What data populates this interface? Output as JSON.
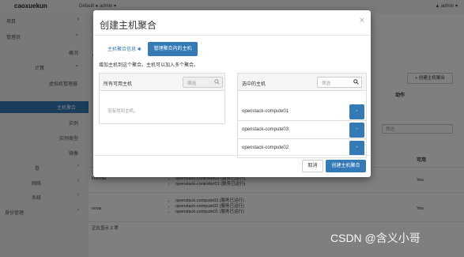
{
  "topbar": {
    "brand": "caoxuekun",
    "project": "Default ● admin ▾",
    "user": "▲ admin ▾"
  },
  "sidebar": {
    "items": [
      {
        "label": "项目",
        "chevron": "›"
      },
      {
        "label": "管理员",
        "chevron": "⌄"
      },
      {
        "label": "概况",
        "chevron": ""
      },
      {
        "label": "计算",
        "chevron": "⌄"
      },
      {
        "label": "虚拟机管理器",
        "chevron": ""
      },
      {
        "label": "主机聚合",
        "chevron": ""
      },
      {
        "label": "实例",
        "chevron": ""
      },
      {
        "label": "实例类型",
        "chevron": ""
      },
      {
        "label": "镜像",
        "chevron": ""
      },
      {
        "label": "卷",
        "chevron": "›"
      },
      {
        "label": "网络",
        "chevron": "›"
      },
      {
        "label": "系统",
        "chevron": "›"
      },
      {
        "label": "身份管理",
        "chevron": "›"
      }
    ]
  },
  "background": {
    "title": "三",
    "create_button": "+ 创建主机聚合",
    "action_header": "动作",
    "filter_placeholder": "筛选",
    "available_header": "可用",
    "rows": [
      {
        "name": "internal",
        "hosts": [
          "openstack-controller02 (服务已运行)",
          "openstack-controller01 (服务已运行)"
        ],
        "available": "Yes"
      },
      {
        "name": "nova",
        "hosts": [
          "openstack-compute03 (服务已运行)",
          "openstack-compute02 (服务已运行)",
          "openstack-compute01 (服务已运行)"
        ],
        "available": "Yes"
      }
    ],
    "count_text": "正在显示 2 项"
  },
  "modal": {
    "title": "创建主机聚合",
    "close": "×",
    "tabs": [
      {
        "label": "主机聚合信息",
        "required_mark": "✱"
      },
      {
        "label": "管理聚合内的主机"
      }
    ],
    "help_text": "增加主机到这个聚合。主机可以加入多个聚合。",
    "left_panel": {
      "title": "所有可用主机",
      "filter_placeholder": "筛选",
      "empty_text": "没有找到主机。"
    },
    "right_panel": {
      "title": "选中的主机",
      "filter_placeholder": "筛选",
      "hosts": [
        {
          "name": "openstack-compute01",
          "button": "-"
        },
        {
          "name": "openstack-compute03",
          "button": "-"
        },
        {
          "name": "openstack-compute02",
          "button": "-"
        }
      ]
    },
    "cancel_label": "取消",
    "submit_label": "创建主机聚合"
  },
  "watermark": "CSDN @含义小哥",
  "colors": {
    "primary": "#337ab7",
    "backdrop": "rgba(0,0,0,0.5)"
  }
}
